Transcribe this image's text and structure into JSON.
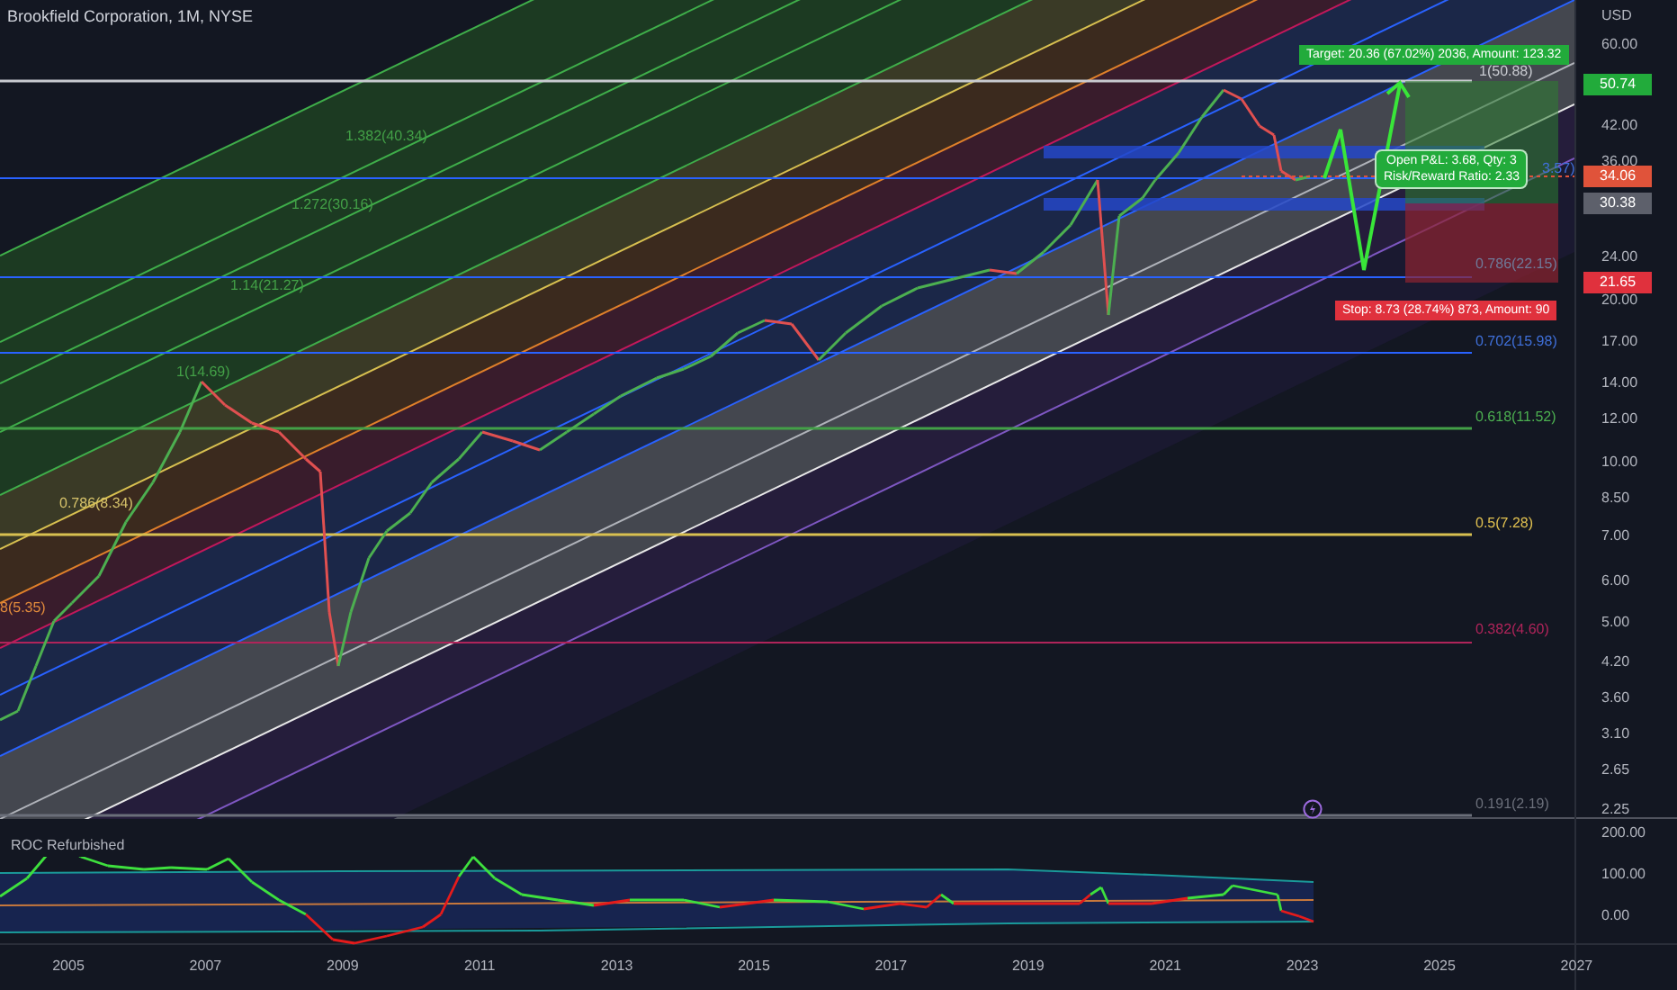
{
  "chart": {
    "title": "Brookfield Corporation, 1M, NYSE",
    "fib_labels": [
      {
        "text": "1.382(40.34)",
        "color": "#43a047"
      },
      {
        "text": "1.272(30.16)",
        "color": "#43a047"
      },
      {
        "text": "1.14(21.27)",
        "color": "#43a047"
      },
      {
        "text": "1(14.69)",
        "color": "#43a047"
      },
      {
        "text": "0.786(8.34)",
        "color": "#d6c26a"
      },
      {
        "text": "8(5.35)",
        "color": "#e08a3c"
      },
      {
        "text": "1(50.88)",
        "color": "#c8cad0"
      },
      {
        "text": "3.57)",
        "color": "#3f6fd8"
      },
      {
        "text": "0.786(22.15)",
        "color": "#6f7a99"
      },
      {
        "text": "0.702(15.98)",
        "color": "#3f6fd8"
      },
      {
        "text": "0.618(11.52)",
        "color": "#4caf50"
      },
      {
        "text": "0.5(7.28)",
        "color": "#e0c050"
      },
      {
        "text": "0.382(4.60)",
        "color": "#b0245a"
      },
      {
        "text": "0.191(2.19)",
        "color": "#6b6f7a"
      }
    ],
    "position_tool": {
      "target": "Target: 20.36 (67.02%) 2036, Amount: 123.32",
      "open_pl": "Open P&L: 3.68, Qty: 3",
      "risk_reward": "Risk/Reward Ratio: 2.33",
      "stop": "Stop: 8.73 (28.74%) 873, Amount: 90"
    }
  },
  "price_axis": {
    "unit": "USD",
    "ticks": [
      "60.00",
      "42.00",
      "36.00",
      "24.00",
      "20.00",
      "17.00",
      "14.00",
      "12.00",
      "10.00",
      "8.50",
      "7.00",
      "6.00",
      "5.00",
      "4.20",
      "3.60",
      "3.10",
      "2.65",
      "2.25"
    ],
    "badges": [
      {
        "text": "50.74",
        "color": "#22ab3b"
      },
      {
        "text": "34.06",
        "color": "#e0533a"
      },
      {
        "text": "30.38",
        "color": "#5d606b"
      },
      {
        "text": "21.65",
        "color": "#e0313d"
      }
    ]
  },
  "indicator": {
    "title": "ROC Refurbished",
    "ticks": [
      "200.00",
      "100.00",
      "0.00"
    ]
  },
  "time_axis": [
    "2005",
    "2007",
    "2009",
    "2011",
    "2013",
    "2015",
    "2017",
    "2019",
    "2021",
    "2023",
    "2025",
    "2027"
  ]
}
